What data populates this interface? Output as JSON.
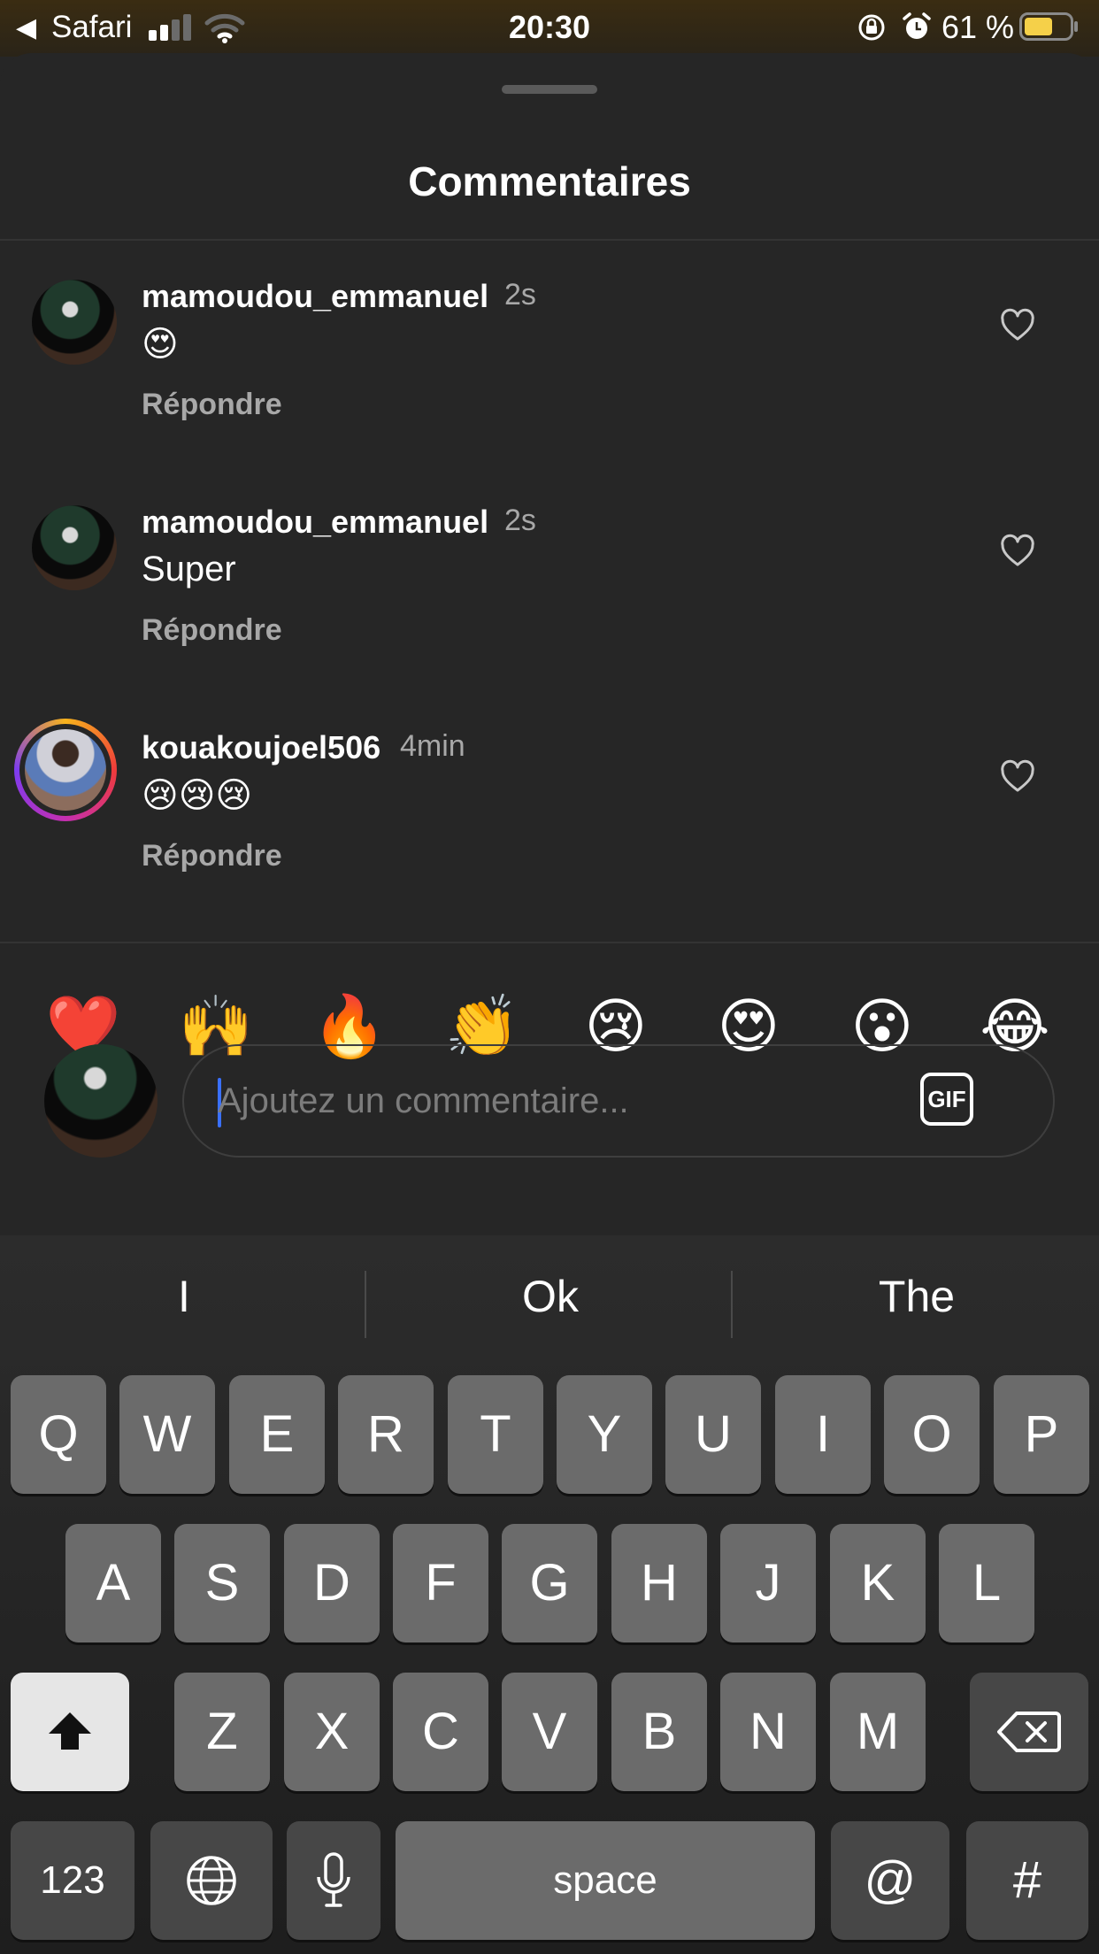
{
  "status_bar": {
    "back_app": "Safari",
    "back_icon": "back-arrow-icon",
    "time": "20:30",
    "battery_percent": "61 %",
    "battery_level": 0.61,
    "battery_color": "#f5d049"
  },
  "sheet": {
    "title": "Commentaires"
  },
  "comments": [
    {
      "username": "mamoudou_emmanuel",
      "time": "2s",
      "text": "😍",
      "reply_label": "Répondre"
    },
    {
      "username": "mamoudou_emmanuel",
      "time": "2s",
      "text": "Super",
      "reply_label": "Répondre"
    },
    {
      "username": "kouakoujoel506",
      "time": "4min",
      "text": "😢😢😢",
      "reply_label": "Répondre"
    }
  ],
  "quick_emojis": [
    "❤️",
    "🙌",
    "🔥",
    "👏",
    "😢",
    "😍",
    "😮",
    "😂"
  ],
  "composer": {
    "placeholder": "Ajoutez un commentaire...",
    "gif_label": "GIF"
  },
  "keyboard": {
    "suggestions": [
      "I",
      "Ok",
      "The"
    ],
    "row1": [
      "Q",
      "W",
      "E",
      "R",
      "T",
      "Y",
      "U",
      "I",
      "O",
      "P"
    ],
    "row2": [
      "A",
      "S",
      "D",
      "F",
      "G",
      "H",
      "J",
      "K",
      "L"
    ],
    "row3": [
      "Z",
      "X",
      "C",
      "V",
      "B",
      "N",
      "M"
    ],
    "numbers_label": "123",
    "space_label": "space",
    "at_label": "@",
    "hash_label": "#"
  },
  "colors": {
    "background": "#262626",
    "caret": "#3a70ff",
    "muted_text": "#a8a8a8"
  }
}
